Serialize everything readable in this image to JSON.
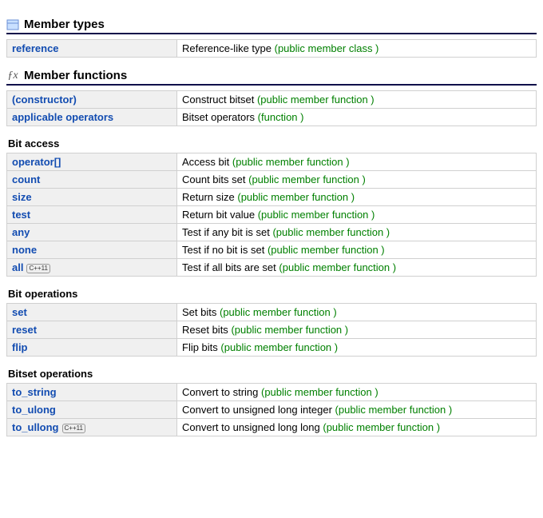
{
  "sections": [
    {
      "title": "Member types",
      "icon": "class",
      "groups": [
        {
          "title": null,
          "rows": [
            {
              "name": "reference",
              "desc": "Reference-like type",
              "type": "(public member class )",
              "cpp11": false
            }
          ]
        }
      ]
    },
    {
      "title": "Member functions",
      "icon": "fx",
      "groups": [
        {
          "title": null,
          "rows": [
            {
              "name": "(constructor)",
              "desc": "Construct bitset",
              "type": "(public member function )",
              "cpp11": false
            },
            {
              "name": "applicable operators",
              "desc": "Bitset operators",
              "type": "(function )",
              "cpp11": false
            }
          ]
        },
        {
          "title": "Bit access",
          "rows": [
            {
              "name": "operator[]",
              "desc": "Access bit",
              "type": "(public member function )",
              "cpp11": false
            },
            {
              "name": "count",
              "desc": "Count bits set",
              "type": "(public member function )",
              "cpp11": false
            },
            {
              "name": "size",
              "desc": "Return size",
              "type": "(public member function )",
              "cpp11": false
            },
            {
              "name": "test",
              "desc": "Return bit value",
              "type": "(public member function )",
              "cpp11": false
            },
            {
              "name": "any",
              "desc": "Test if any bit is set",
              "type": "(public member function )",
              "cpp11": false
            },
            {
              "name": "none",
              "desc": "Test if no bit is set",
              "type": "(public member function )",
              "cpp11": false
            },
            {
              "name": "all",
              "desc": "Test if all bits are set",
              "type": "(public member function )",
              "cpp11": true
            }
          ]
        },
        {
          "title": "Bit operations",
          "rows": [
            {
              "name": "set",
              "desc": "Set bits",
              "type": "(public member function )",
              "cpp11": false
            },
            {
              "name": "reset",
              "desc": "Reset bits",
              "type": "(public member function )",
              "cpp11": false
            },
            {
              "name": "flip",
              "desc": "Flip bits",
              "type": "(public member function )",
              "cpp11": false
            }
          ]
        },
        {
          "title": "Bitset operations",
          "rows": [
            {
              "name": "to_string",
              "desc": "Convert to string",
              "type": "(public member function )",
              "cpp11": false
            },
            {
              "name": "to_ulong",
              "desc": "Convert to unsigned long integer",
              "type": "(public member function )",
              "cpp11": false
            },
            {
              "name": "to_ullong",
              "desc": "Convert to unsigned long long",
              "type": "(public member function )",
              "cpp11": true
            }
          ]
        }
      ]
    }
  ],
  "badge_label": "C++11"
}
